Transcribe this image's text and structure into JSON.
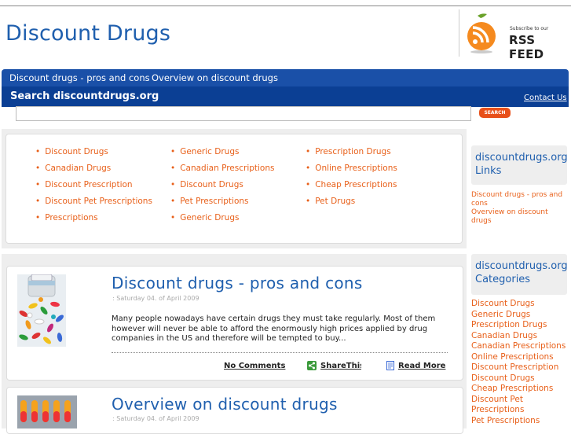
{
  "header": {
    "site_title": "Discount Drugs",
    "rss_subscribe": "Subscribe to our",
    "rss_feed": "RSS FEED"
  },
  "nav": {
    "items": [
      "Discount drugs - pros and cons",
      "Overview on discount drugs"
    ]
  },
  "search": {
    "label": "Search discountdrugs.org",
    "contact": "Contact Us",
    "button": "SEARCH",
    "value": ""
  },
  "links_grid": {
    "col1": [
      "Discount Drugs",
      "Canadian Drugs",
      "Discount Prescription",
      "Discount Pet Prescriptions",
      "Prescriptions"
    ],
    "col2": [
      "Generic Drugs",
      "Canadian Prescriptions",
      "Discount Drugs",
      "Pet Prescriptions",
      "Generic Drugs"
    ],
    "col3": [
      "Prescription Drugs",
      "Online Prescriptions",
      "Cheap Prescriptions",
      "Pet Drugs"
    ]
  },
  "sidebar": {
    "links_title": "discountdrugs.org Links",
    "links": [
      "Discount drugs - pros and cons",
      "Overview on discount drugs"
    ],
    "categories_title": "discountdrugs.org Categories",
    "categories": [
      "Discount Drugs",
      "Generic Drugs",
      "Prescription Drugs",
      "Canadian Drugs",
      "Canadian Prescriptions",
      "Online Prescriptions",
      "Discount Prescription",
      "Discount Drugs",
      "Cheap Prescriptions",
      "Discount Pet Prescriptions",
      "Pet Prescriptions"
    ]
  },
  "posts": [
    {
      "title": "Discount drugs - pros and cons",
      "date": ": Saturday 04. of April 2009",
      "excerpt": "Many people nowadays have certain drugs they must take regularly. Most of them however will never be able to afford  the enormously high prices applied by drug companies in the US and therefore will be tempted to buy...",
      "comments": "No Comments",
      "share": "ShareThis",
      "read_more": "Read More"
    },
    {
      "title": "Overview on discount drugs",
      "date": ": Saturday 04. of April 2009"
    }
  ],
  "colors": {
    "brand_blue": "#1f5fae",
    "nav_blue": "#1a50a8",
    "accent_orange": "#e8601a"
  }
}
